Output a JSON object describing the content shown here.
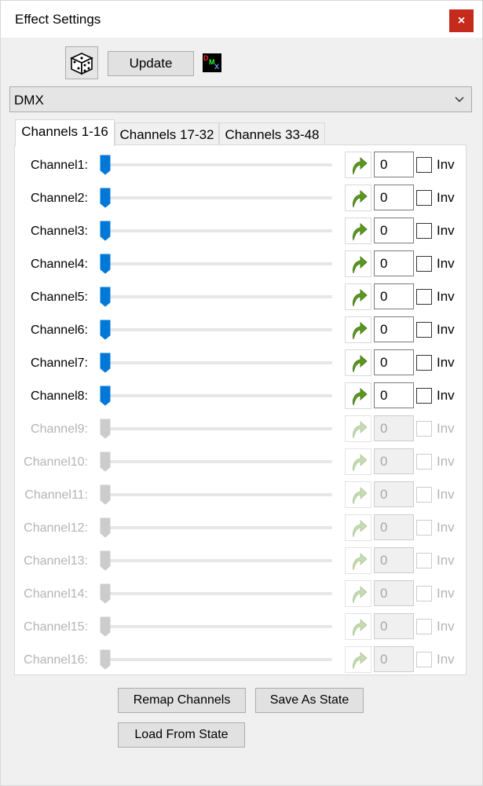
{
  "window": {
    "title": "Effect Settings",
    "close_icon": "close-icon",
    "close_glyph": "×",
    "accent_close": "#c42b1c"
  },
  "toolbar": {
    "dice_icon": "dice-icon",
    "update_label": "Update",
    "dmx_icon": "dmx-icon",
    "dmx_letters": [
      "D",
      "M",
      "X"
    ]
  },
  "effect_select": {
    "value": "DMX",
    "chevron_icon": "chevron-down-icon"
  },
  "tabs": [
    {
      "label": "Channels 1-16",
      "active": true
    },
    {
      "label": "Channels 17-32",
      "active": false
    },
    {
      "label": "Channels 33-48",
      "active": false
    }
  ],
  "channels": [
    {
      "label": "Channel1:",
      "value": "0",
      "inv_label": "Inv",
      "enabled": true,
      "slider_level": 0,
      "inverted": false
    },
    {
      "label": "Channel2:",
      "value": "0",
      "inv_label": "Inv",
      "enabled": true,
      "slider_level": 0,
      "inverted": false
    },
    {
      "label": "Channel3:",
      "value": "0",
      "inv_label": "Inv",
      "enabled": true,
      "slider_level": 0,
      "inverted": false
    },
    {
      "label": "Channel4:",
      "value": "0",
      "inv_label": "Inv",
      "enabled": true,
      "slider_level": 0,
      "inverted": false
    },
    {
      "label": "Channel5:",
      "value": "0",
      "inv_label": "Inv",
      "enabled": true,
      "slider_level": 0,
      "inverted": false
    },
    {
      "label": "Channel6:",
      "value": "0",
      "inv_label": "Inv",
      "enabled": true,
      "slider_level": 0,
      "inverted": false
    },
    {
      "label": "Channel7:",
      "value": "0",
      "inv_label": "Inv",
      "enabled": true,
      "slider_level": 0,
      "inverted": false
    },
    {
      "label": "Channel8:",
      "value": "0",
      "inv_label": "Inv",
      "enabled": true,
      "slider_level": 0,
      "inverted": false
    },
    {
      "label": "Channel9:",
      "value": "0",
      "inv_label": "Inv",
      "enabled": false,
      "slider_level": 0,
      "inverted": false
    },
    {
      "label": "Channel10:",
      "value": "0",
      "inv_label": "Inv",
      "enabled": false,
      "slider_level": 0,
      "inverted": false
    },
    {
      "label": "Channel11:",
      "value": "0",
      "inv_label": "Inv",
      "enabled": false,
      "slider_level": 0,
      "inverted": false
    },
    {
      "label": "Channel12:",
      "value": "0",
      "inv_label": "Inv",
      "enabled": false,
      "slider_level": 0,
      "inverted": false
    },
    {
      "label": "Channel13:",
      "value": "0",
      "inv_label": "Inv",
      "enabled": false,
      "slider_level": 0,
      "inverted": false
    },
    {
      "label": "Channel14:",
      "value": "0",
      "inv_label": "Inv",
      "enabled": false,
      "slider_level": 0,
      "inverted": false
    },
    {
      "label": "Channel15:",
      "value": "0",
      "inv_label": "Inv",
      "enabled": false,
      "slider_level": 0,
      "inverted": false
    },
    {
      "label": "Channel16:",
      "value": "0",
      "inv_label": "Inv",
      "enabled": false,
      "slider_level": 0,
      "inverted": false
    }
  ],
  "channel_icons": {
    "slider_thumb": "slider-thumb-icon",
    "copy": "copy-arrow-icon"
  },
  "colors": {
    "slider_enabled": "#0078d7",
    "slider_disabled": "#cccccc",
    "copy_arrow_enabled": "#5a9a1a",
    "copy_arrow_disabled": "#c8dcb4"
  },
  "buttons": {
    "remap": "Remap Channels",
    "save_state": "Save As State",
    "load_state": "Load From State"
  }
}
